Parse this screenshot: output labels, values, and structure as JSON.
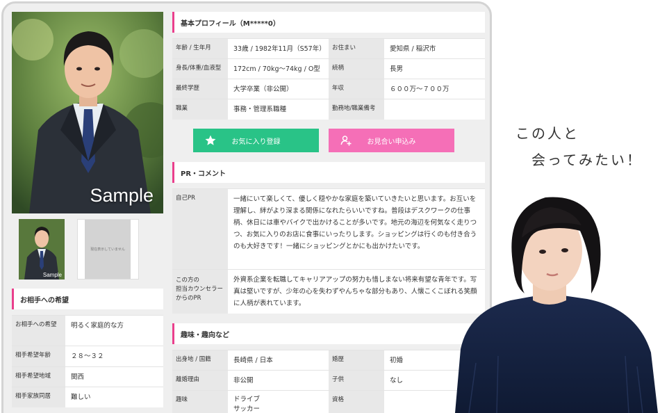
{
  "photo": {
    "sample_label": "Sample",
    "thumb_sample_label": "Sample",
    "no_image_label": "現在表示していません"
  },
  "basic": {
    "heading": "基本プロフィール（M*****0）",
    "rows": [
      {
        "l1": "年齢 / 生年月",
        "v1": "33歳 / 1982年11月（S57年）",
        "l2": "お住まい",
        "v2": "愛知県 / 稲沢市"
      },
      {
        "l1": "身長/体重/血液型",
        "v1": "172cm / 70kg〜74kg / O型",
        "l2": "続柄",
        "v2": "長男"
      },
      {
        "l1": "最終学歴",
        "v1": "大学卒業（非公開）",
        "l2": "年収",
        "v2": "６００万〜７００万"
      },
      {
        "l1": "職業",
        "v1": "事務・管理系職種",
        "l2": "勤務地/職業備考",
        "v2": ""
      }
    ]
  },
  "buttons": {
    "favorite": "お気に入り登録",
    "meeting": "お見合い申込み"
  },
  "pr": {
    "heading": "PR・コメント",
    "self_label": "自己PR",
    "self_text": "一緒にいて楽しくて、優しく穏やかな家庭を築いていきたいと思います。お互いを理解し、絆がより深まる関係になれたらいいですね。普段はデスクワークの仕事柄、休日には車やバイクで出かけることが多いです。地元の海辺を何気なく走りつつ、お気に入りのお店に食事にいったりします。ショッピングは行くのも付き合うのも大好きです！一緒にショッピングとかにも出かけたいです。",
    "counselor_label_1": "この方の",
    "counselor_label_2": "担当カウンセラー",
    "counselor_label_3": "からのPR",
    "counselor_text": "外資系企業を転職してキャリアアップの努力も惜しまない将来有望な青年です。写真は堅いですが、少年の心を失わずやんちゃな部分もあり、人懐こくこぼれる笑顔に人柄が表れています。"
  },
  "hobby": {
    "heading": "趣味・趣向など",
    "rows": [
      {
        "l1": "出身地 / 国籍",
        "v1": "長崎県 / 日本",
        "l2": "婚歴",
        "v2": "初婚"
      },
      {
        "l1": "離婚理由",
        "v1": "非公開",
        "l2": "子供",
        "v2": "なし"
      },
      {
        "l1": "趣味",
        "v1a": "ドライブ",
        "v1b": "サッカー",
        "l2": "資格",
        "v2": ""
      }
    ]
  },
  "partner": {
    "heading": "お相手への希望",
    "rows": [
      {
        "label": "お相手への希望",
        "value": "明るく家庭的な方"
      },
      {
        "label": "相手希望年齢",
        "value": "２８〜３２"
      },
      {
        "label": "相手希望地域",
        "value": "関西"
      },
      {
        "label": "相手家族同居",
        "value": "難しい"
      }
    ]
  },
  "speech": {
    "line1": "この人と",
    "line2": "会ってみたい！"
  },
  "colors": {
    "accent_pink": "#ea3f8c",
    "favorite_green": "#29c387",
    "meeting_pink": "#f56fb7"
  }
}
